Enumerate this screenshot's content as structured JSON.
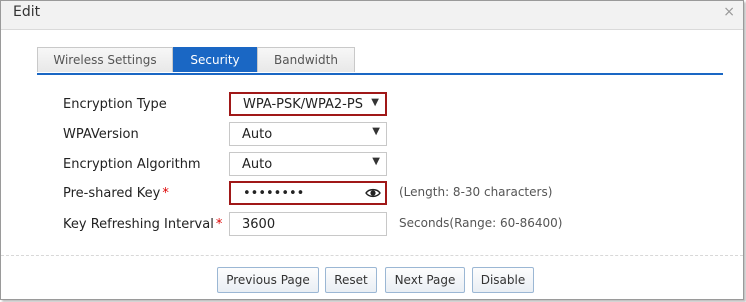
{
  "dialog": {
    "title": "Edit",
    "close_glyph": "×"
  },
  "tabs": [
    {
      "label": "Wireless Settings",
      "active": false
    },
    {
      "label": "Security",
      "active": true
    },
    {
      "label": "Bandwidth",
      "active": false
    }
  ],
  "form": {
    "encryption_type": {
      "label": "Encryption Type",
      "value": "WPA-PSK/WPA2-PS"
    },
    "wpa_version": {
      "label": "WPAVersion",
      "value": "Auto"
    },
    "encryption_algorithm": {
      "label": "Encryption Algorithm",
      "value": "Auto"
    },
    "pre_shared_key": {
      "label": "Pre-shared Key",
      "value": "••••••••",
      "hint": "(Length: 8-30 characters)"
    },
    "key_refresh": {
      "label": "Key Refreshing Interval",
      "value": "3600",
      "hint": "Seconds(Range: 60-86400)"
    },
    "required_mark": "*"
  },
  "buttons": {
    "previous": "Previous Page",
    "reset": "Reset",
    "next": "Next Page",
    "disable": "Disable"
  },
  "colors": {
    "accent": "#1a67c4",
    "highlight_border": "#a01818",
    "required": "#dd0000"
  }
}
